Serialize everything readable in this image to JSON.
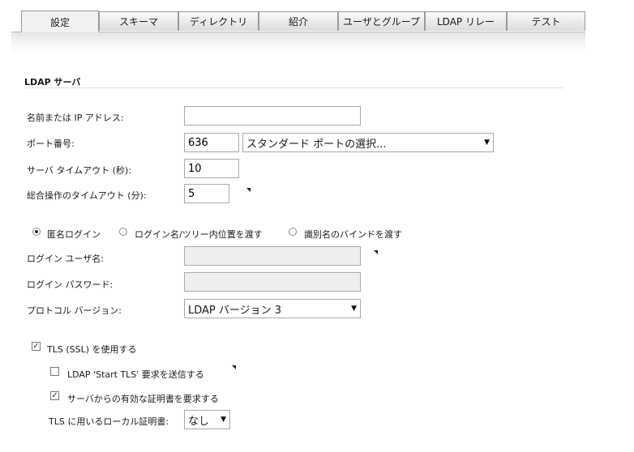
{
  "tabs": [
    {
      "label": "設定",
      "active": true
    },
    {
      "label": "スキーマ"
    },
    {
      "label": "ディレクトリ"
    },
    {
      "label": "紹介"
    },
    {
      "label": "ユーザとグループ"
    },
    {
      "label": "LDAP リレー"
    },
    {
      "label": "テスト"
    }
  ],
  "section": {
    "title": "LDAP サーバ"
  },
  "form": {
    "host": {
      "label": "名前または IP アドレス:",
      "value": ""
    },
    "port": {
      "label": "ポート番号:",
      "value": "636",
      "select_value": "スタンダード ポートの選択..."
    },
    "server_timeout": {
      "label": "サーバ タイムアウト (秒):",
      "value": "10"
    },
    "total_timeout": {
      "label": "総合操作のタイムアウト (分):",
      "value": "5"
    },
    "login_mode": {
      "options": [
        "匿名ログイン",
        "ログイン名/ツリー内位置を渡す",
        "識別名のバインドを渡す"
      ],
      "selected": 0
    },
    "login_user": {
      "label": "ログイン ユーザ名:",
      "value": ""
    },
    "login_password": {
      "label": "ログイン パスワード:",
      "value": ""
    },
    "protocol": {
      "label": "プロトコル バージョン:",
      "value": "LDAP バージョン 3"
    },
    "use_tls": {
      "label": "TLS (SSL) を使用する",
      "checked": true
    },
    "start_tls": {
      "label": "LDAP 'Start TLS' 要求を送信する",
      "checked": false
    },
    "require_cert": {
      "label": "サーバからの有効な証明書を要求する",
      "checked": true
    },
    "local_cert": {
      "label": "TLS に用いるローカル証明書:",
      "value": "なし"
    }
  }
}
